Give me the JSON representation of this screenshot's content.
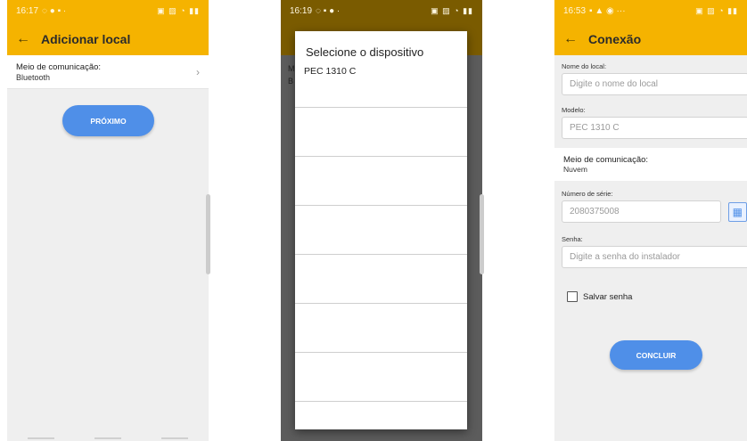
{
  "screen1": {
    "status_time": "16:17",
    "title": "Adicionar local",
    "comm_label": "Meio de comunicação:",
    "comm_value": "Bluetooth",
    "next_button": "PRÓXIMO"
  },
  "screen2": {
    "status_time": "16:19",
    "dialog_title": "Selecione o dispositivo",
    "devices": [
      "PEC 1310 C",
      "",
      "",
      "",
      "",
      "",
      "",
      ""
    ]
  },
  "screen3": {
    "status_time": "16:53",
    "title": "Conexão",
    "name_label": "Nome do local:",
    "name_placeholder": "Digite o nome do local",
    "model_label": "Modelo:",
    "model_value": "PEC 1310 C",
    "comm_label": "Meio de comunicação:",
    "comm_value": "Nuvem",
    "serial_label": "Número de série:",
    "serial_value": "2080375008",
    "password_label": "Senha:",
    "password_placeholder": "Digite a senha do instalador",
    "save_password_label": "Salvar senha",
    "conclude_button": "CONCLUIR"
  },
  "icons": {
    "back": "arrow-left-icon",
    "chevron": "chevron-right-icon",
    "qr": "qr-code-icon"
  },
  "colors": {
    "appbar": "#f5b300",
    "primary_button": "#4f8fe8"
  }
}
